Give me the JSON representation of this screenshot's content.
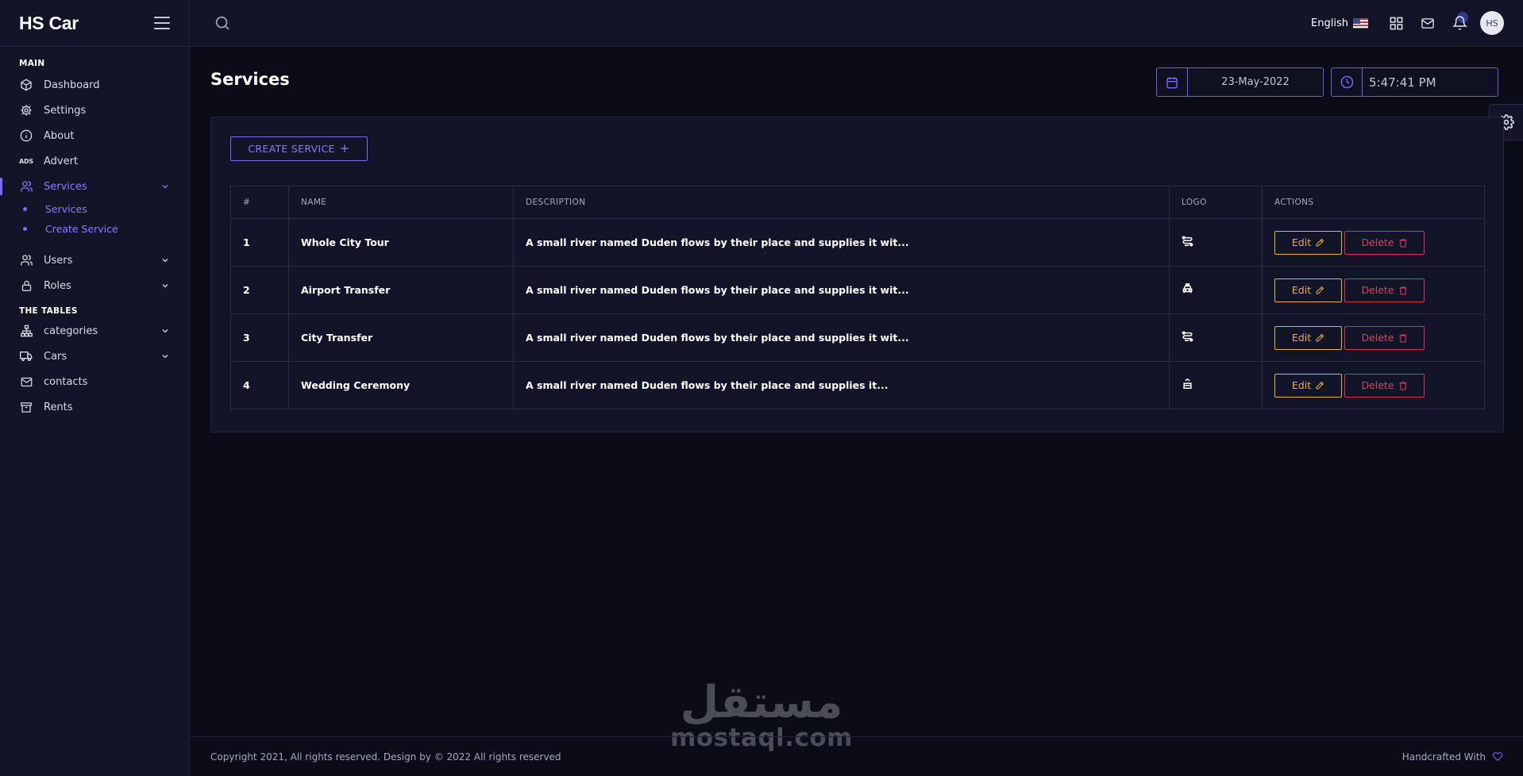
{
  "app": {
    "brand": "HS Car"
  },
  "sidebar": {
    "sections": [
      {
        "label": "MAIN"
      },
      {
        "label": "THE TABLES"
      }
    ],
    "items": [
      {
        "label": "Dashboard",
        "icon": "cube-icon"
      },
      {
        "label": "Settings",
        "icon": "gear-icon"
      },
      {
        "label": "About",
        "icon": "info-icon"
      },
      {
        "label": "Advert",
        "icon": "ads-icon",
        "icon_text": "ADS"
      },
      {
        "label": "Services",
        "icon": "users-icon",
        "active": true
      },
      {
        "label": "Users",
        "icon": "user-icon"
      },
      {
        "label": "Roles",
        "icon": "lock-icon"
      },
      {
        "label": "categories",
        "icon": "sitemap-icon"
      },
      {
        "label": "Cars",
        "icon": "truck-icon"
      },
      {
        "label": "contacts",
        "icon": "mail-icon"
      },
      {
        "label": "Rents",
        "icon": "archive-icon"
      }
    ],
    "services_sub": [
      {
        "label": "Services"
      },
      {
        "label": "Create Service"
      }
    ]
  },
  "topbar": {
    "language": "English",
    "avatar_initials": "HS"
  },
  "page": {
    "title": "Services",
    "date": "23-May-2022",
    "time": "5:47:41 PM",
    "create_button": "CREATE SERVICE"
  },
  "table": {
    "headers": [
      "#",
      "NAME",
      "DESCRIPTION",
      "LOGO",
      "ACTIONS"
    ],
    "rows": [
      {
        "num": "1",
        "name": "Whole City Tour",
        "description": "A small river named Duden flows by their place and supplies it wit...",
        "logo": "route-icon"
      },
      {
        "num": "2",
        "name": "Airport Transfer",
        "description": "A small river named Duden flows by their place and supplies it wit...",
        "logo": "taxi-icon"
      },
      {
        "num": "3",
        "name": "City Transfer",
        "description": "A small river named Duden flows by their place and supplies it wit...",
        "logo": "route-icon"
      },
      {
        "num": "4",
        "name": "Wedding Ceremony",
        "description": "A small river named Duden flows by their place and supplies it...",
        "logo": "cake-icon"
      }
    ],
    "edit_label": "Edit",
    "delete_label": "Delete"
  },
  "footer": {
    "copyright": "Copyright 2021, All rights reserved. Design by © 2022 All rights reserved",
    "handcrafted": "Handcrafted With"
  },
  "watermark": {
    "arabic": "مستقل",
    "latin": "mostaql.com"
  },
  "colors": {
    "accent": "#7a6cf5",
    "edit": "#e9b339",
    "delete": "#e03d63",
    "background": "#0b0c17",
    "panel": "#121427"
  }
}
